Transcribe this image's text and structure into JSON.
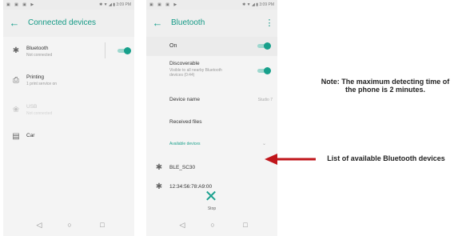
{
  "phone1": {
    "status_left": "▣ ▣ ▣ ▶",
    "status_right": "✱ ▼ ◢ ▮ 3:09 PM",
    "title": "Connected devices",
    "items": [
      {
        "icon": "✱",
        "label": "Bluetooth",
        "sub": "Not connected"
      },
      {
        "icon": "⎙",
        "label": "Printing",
        "sub": "1 print service on"
      },
      {
        "icon": "❀",
        "label": "USB",
        "sub": "Not connected"
      },
      {
        "icon": "▤",
        "label": "Car",
        "sub": ""
      }
    ],
    "nav": {
      "back": "◁",
      "home": "○",
      "recents": "□"
    }
  },
  "phone2": {
    "status_left": "▣ ▣ ▣ ▶",
    "status_right": "✱ ▼ ◢ ▮ 3:09 PM",
    "title": "Bluetooth",
    "menu": "⋮",
    "on_label": "On",
    "discoverable_label": "Discoverable",
    "discoverable_sub": "Visible to all nearby Bluetooth devices (0:44)",
    "device_name_label": "Device name",
    "device_name_value": "Studio 7",
    "received_files": "Received files",
    "available_devices": "Available devices",
    "devices": [
      {
        "icon": "✱",
        "name": "BLE_SC30"
      },
      {
        "icon": "✱",
        "name": "12:34:56:78:A9:00"
      }
    ],
    "stop_icon": "✕",
    "stop_label": "Stop",
    "nav": {
      "back": "◁",
      "home": "○",
      "recents": "□"
    }
  },
  "annotations": {
    "note": "Note: The maximum detecting time of the phone is 2 minutes.",
    "list": "List of available Bluetooth devices",
    "arrow_color": "#c0161b"
  },
  "colors": {
    "accent": "#159a86",
    "toggle_on": "#17a08b"
  }
}
